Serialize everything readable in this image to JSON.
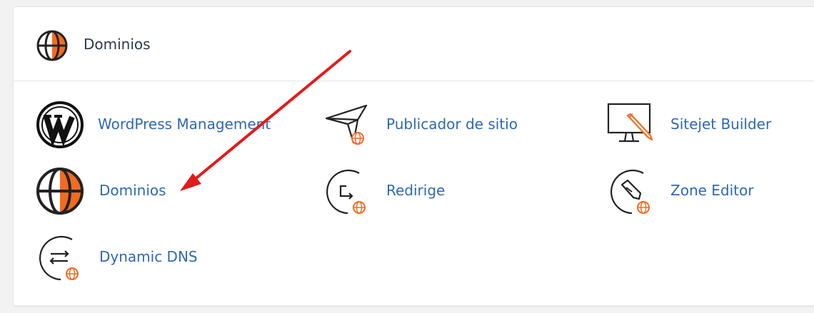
{
  "section": {
    "title": "Dominios",
    "icon": "globe-icon"
  },
  "items": [
    {
      "label": "WordPress Management",
      "icon": "wordpress-icon"
    },
    {
      "label": "Publicador de sitio",
      "icon": "paper-plane-icon"
    },
    {
      "label": "Sitejet Builder",
      "icon": "monitor-pencil-icon"
    },
    {
      "label": "Dominios",
      "icon": "globe-icon"
    },
    {
      "label": "Redirige",
      "icon": "redirect-icon"
    },
    {
      "label": "Zone Editor",
      "icon": "pen-nib-icon"
    },
    {
      "label": "Dynamic DNS",
      "icon": "exchange-arrows-icon"
    }
  ],
  "colors": {
    "link": "#2e69b0",
    "accent": "#f36b21",
    "annotation_arrow": "#e31b1b",
    "icon_stroke": "#222222"
  }
}
